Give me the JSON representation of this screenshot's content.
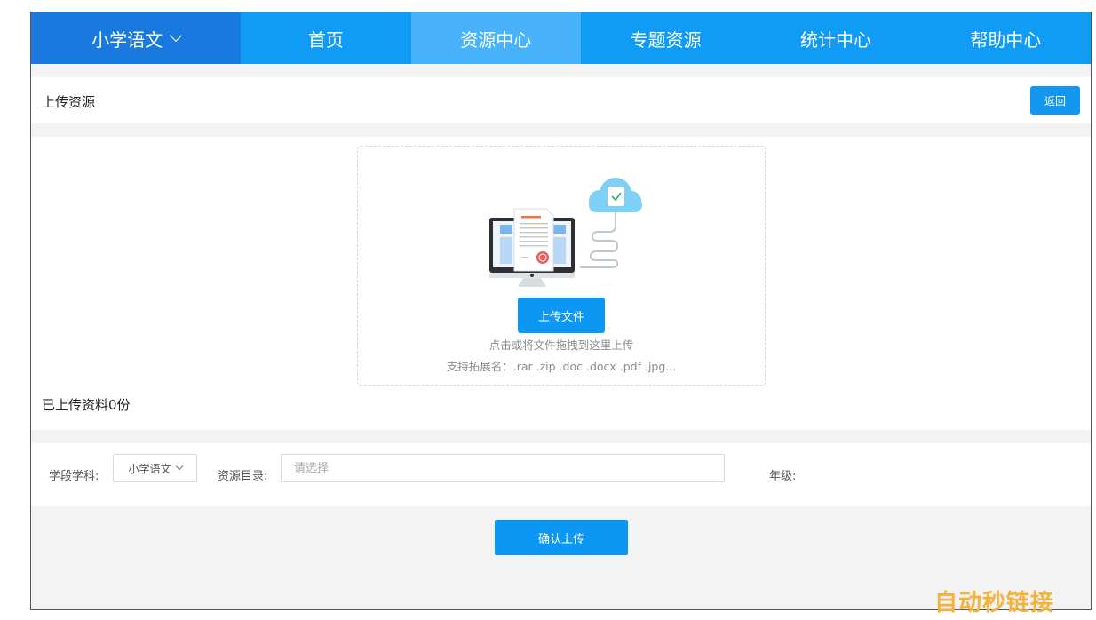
{
  "nav": {
    "subject": "小学语文",
    "items": [
      "首页",
      "资源中心",
      "专题资源",
      "统计中心",
      "帮助中心"
    ],
    "active_index": 1
  },
  "header": {
    "title": "上传资源",
    "back_label": "返回"
  },
  "upload": {
    "button_label": "上传文件",
    "hint_drag": "点击或将文件拖拽到这里上传",
    "hint_ext": "支持拓展名：.rar .zip .doc .docx .pdf .jpg...",
    "uploaded_count_text": "已上传资料0份"
  },
  "form": {
    "subject_label": "学段学科:",
    "subject_value": "小学语文",
    "directory_label": "资源目录:",
    "directory_placeholder": "请选择",
    "grade_label": "年级:"
  },
  "confirm_label": "确认上传",
  "watermark": "自动秒链接",
  "colors": {
    "nav_bg": "#109bf5",
    "nav_subject_bg": "#1a79de",
    "nav_active_bg": "#48b2fb",
    "primary_button": "#0c97f5",
    "watermark": "#f3b23c"
  }
}
